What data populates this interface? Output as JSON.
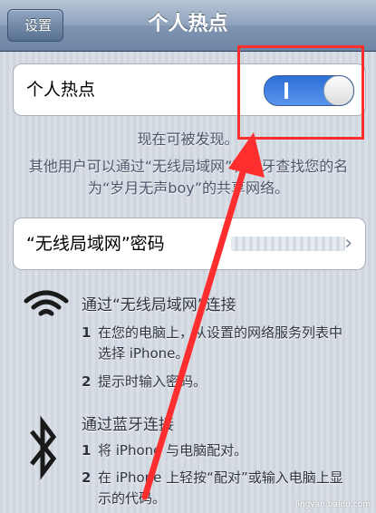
{
  "navbar": {
    "back_label": "设置",
    "title": "个人热点"
  },
  "hotspot_cell": {
    "label": "个人热点",
    "toggle_on": true,
    "toggle_on_glyph": "I"
  },
  "status_text": "现在可被发现。",
  "description": "其他用户可以通过“无线局域网”和蓝牙查找您的名为“岁月无声boy”的共享网络。",
  "password_cell": {
    "label": "“无线局域网”密码",
    "chevron": "›"
  },
  "wifi_section": {
    "icon": "wifi-icon",
    "title": "通过“无线局域网”连接",
    "steps": [
      {
        "num": "1",
        "text": "在您的电脑上，从设置的网络服务列表中选择 iPhone。"
      },
      {
        "num": "2",
        "text": "提示时输入密码。"
      }
    ]
  },
  "bluetooth_section": {
    "icon": "bluetooth-icon",
    "title": "通过蓝牙连接",
    "steps": [
      {
        "num": "1",
        "text": "将 iPhone 与电脑配对。"
      },
      {
        "num": "2",
        "text": "在 iPhone 上轻按“配对”或输入电脑上显示的代码。"
      }
    ]
  },
  "watermark": "jingyan.baidu.com",
  "colors": {
    "annotation": "#ff2e2e",
    "toggle_on": "#2d6fd6",
    "navbar": "#7f95b2"
  }
}
